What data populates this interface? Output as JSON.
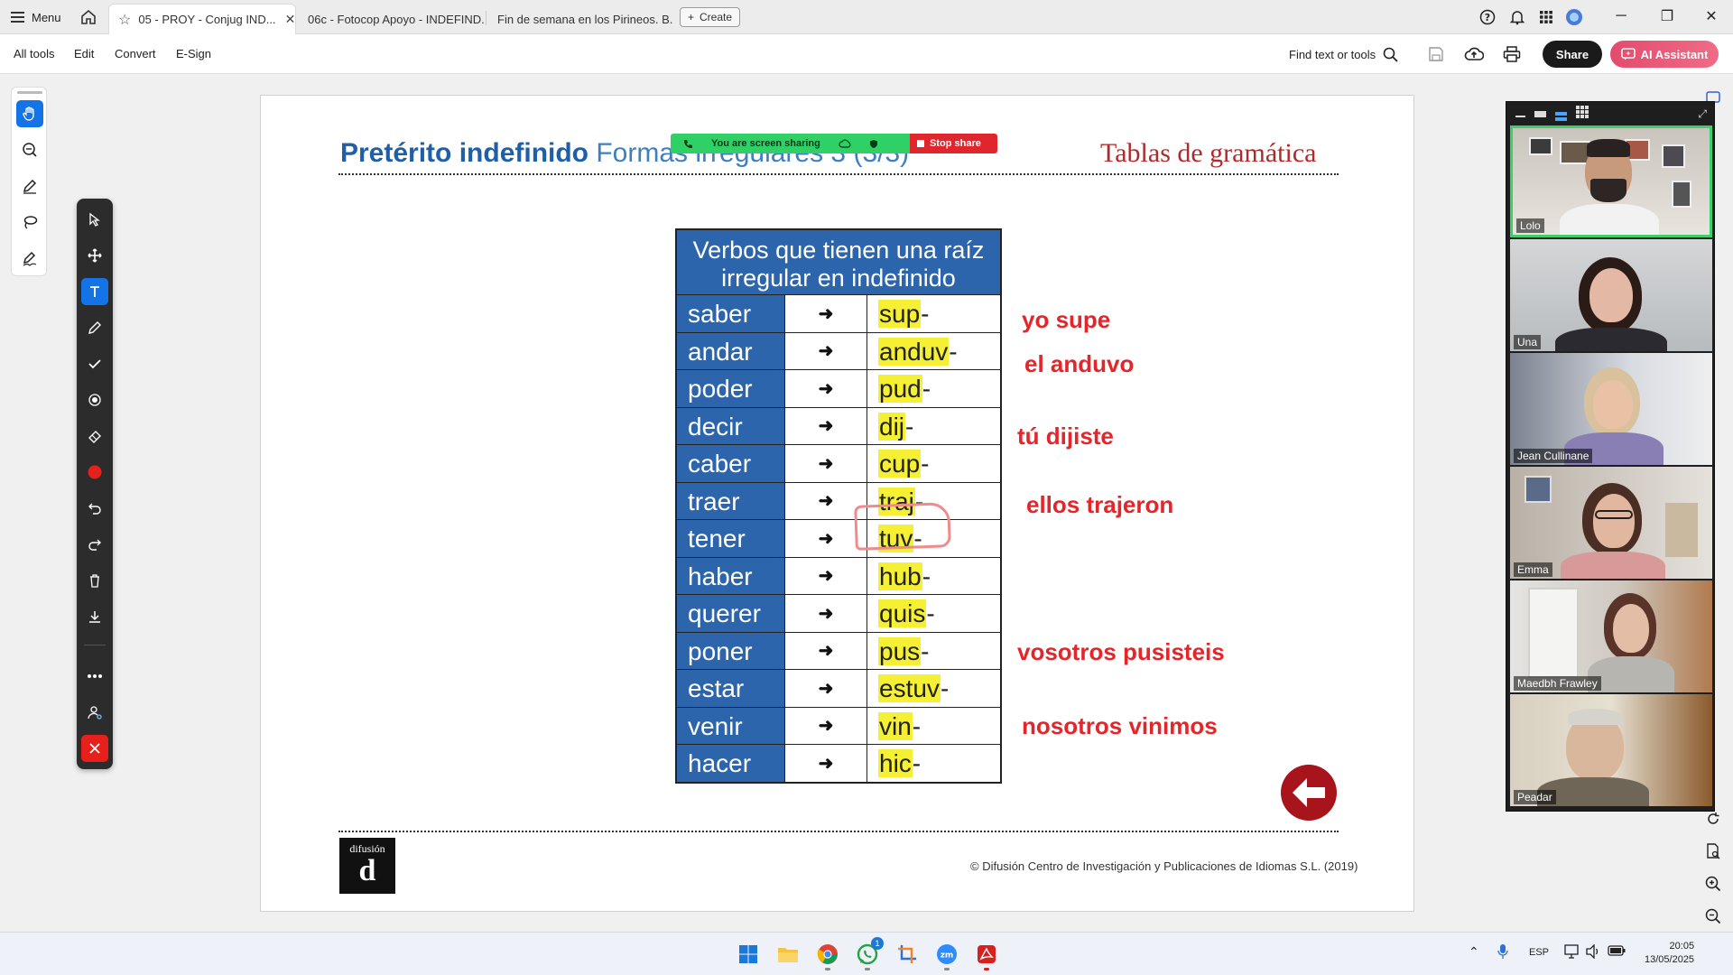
{
  "tabbar": {
    "menu_label": "Menu",
    "tabs": [
      {
        "label": "05 - PROY - Conjug IND...",
        "active": true
      },
      {
        "label": "06c - Fotocop Apoyo - INDEFIND...",
        "active": false
      },
      {
        "label": "Fin de semana en los Pirineos. B...",
        "active": false
      }
    ],
    "create_label": "Create"
  },
  "toolbar": {
    "menus": [
      "All tools",
      "Edit",
      "Convert",
      "E-Sign"
    ],
    "find_label": "Find text or tools",
    "share_label": "Share",
    "ai_label": "AI Assistant"
  },
  "screen_share": {
    "status": "You are screen sharing",
    "stop_label": "Stop share"
  },
  "document": {
    "title_bold": "Pretérito indefinido",
    "title_rest": "Formas irregulares 3 (3/3)",
    "title_right": "Tablas de gramática",
    "table_header": "Verbos que tienen una raíz irregular en indefinido",
    "arrow": "➜",
    "rows": [
      {
        "verb": "saber",
        "stem": "sup",
        "suffix": "-"
      },
      {
        "verb": "andar",
        "stem": "anduv",
        "suffix": "-"
      },
      {
        "verb": "poder",
        "stem": "pud",
        "suffix": "-"
      },
      {
        "verb": "decir",
        "stem": "dij",
        "suffix": "-"
      },
      {
        "verb": "caber",
        "stem": "cup",
        "suffix": "-"
      },
      {
        "verb": "traer",
        "stem": "traj",
        "suffix": "-"
      },
      {
        "verb": "tener",
        "stem": "tuv",
        "suffix": "-"
      },
      {
        "verb": "haber",
        "stem": "hub",
        "suffix": "-"
      },
      {
        "verb": "querer",
        "stem": "quis",
        "suffix": "-"
      },
      {
        "verb": "poner",
        "stem": "pus",
        "suffix": "-"
      },
      {
        "verb": "estar",
        "stem": "estuv",
        "suffix": "-"
      },
      {
        "verb": "venir",
        "stem": "vin",
        "suffix": "-"
      },
      {
        "verb": "hacer",
        "stem": "hic",
        "suffix": "-"
      }
    ],
    "annotations": [
      "yo supe",
      "el anduvo",
      "tú dijiste",
      "ellos trajeron",
      "vosotros pusisteis",
      "nosotros vinimos"
    ],
    "logo_word": "difusión",
    "logo_letter": "d",
    "copyright": "© Difusión Centro de Investigación y Publicaciones de Idiomas S.L. (2019)"
  },
  "participants": [
    {
      "name": "Lolo",
      "active": true
    },
    {
      "name": "Una",
      "active": false
    },
    {
      "name": "Jean Cullinane",
      "active": false
    },
    {
      "name": "Emma",
      "active": false
    },
    {
      "name": "Maedbh Frawley",
      "active": false
    },
    {
      "name": "Peadar",
      "active": false
    }
  ],
  "taskbar": {
    "language": "ESP",
    "time": "20:05",
    "date": "13/05/2025",
    "whatsapp_badge": "1"
  },
  "colors": {
    "table_blue": "#2d65ad",
    "highlight": "#f5f033",
    "annotation_red": "#e4262b",
    "accent_blue": "#1473e6"
  }
}
